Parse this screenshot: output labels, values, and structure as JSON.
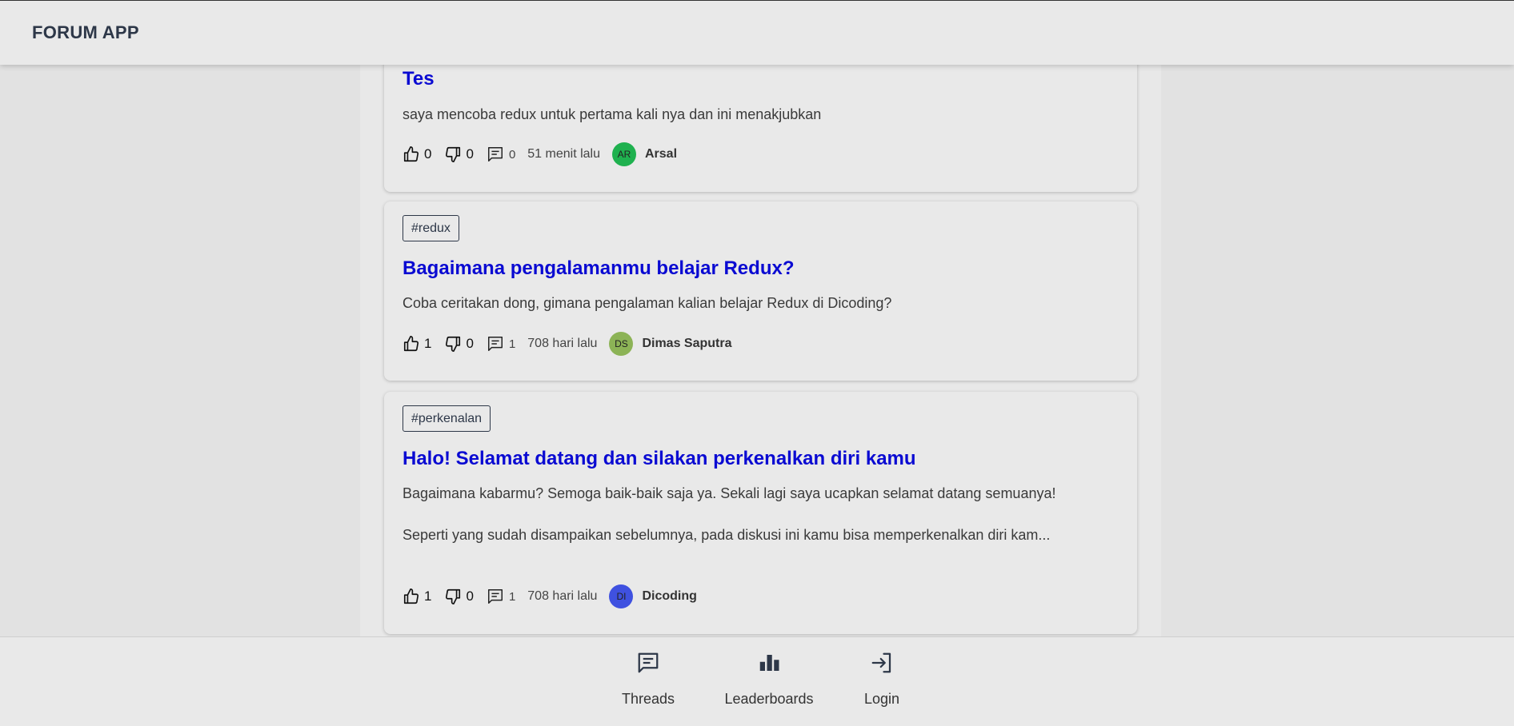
{
  "header": {
    "brand": "FORUM APP"
  },
  "threads": [
    {
      "title": "Tes",
      "body": [
        "saya mencoba redux untuk pertama kali nya dan ini menakjubkan"
      ],
      "upvotes": "0",
      "downvotes": "0",
      "comments": "0",
      "time": "51 menit lalu",
      "author": {
        "initials": "AR",
        "name": "Arsal",
        "color": "#1fb14f"
      }
    },
    {
      "tag": "#redux",
      "title": "Bagaimana pengalamanmu belajar Redux?",
      "body": [
        "Coba ceritakan dong, gimana pengalaman kalian belajar Redux di Dicoding?"
      ],
      "upvotes": "1",
      "downvotes": "0",
      "comments": "1",
      "time": "708 hari lalu",
      "author": {
        "initials": "DS",
        "name": "Dimas Saputra",
        "color": "#8cb356"
      }
    },
    {
      "tag": "#perkenalan",
      "title": "Halo! Selamat datang dan silakan perkenalkan diri kamu",
      "body": [
        "Bagaimana kabarmu? Semoga baik-baik saja ya. Sekali lagi saya ucapkan selamat datang semuanya!",
        "Seperti yang sudah disampaikan sebelumnya, pada diskusi ini kamu bisa memperkenalkan diri kam..."
      ],
      "upvotes": "1",
      "downvotes": "0",
      "comments": "1",
      "time": "708 hari lalu",
      "author": {
        "initials": "DI",
        "name": "Dicoding",
        "color": "#3f51e0"
      }
    }
  ],
  "nav": [
    {
      "label": "Threads",
      "icon": "chat-icon"
    },
    {
      "label": "Leaderboards",
      "icon": "bar-chart-icon"
    },
    {
      "label": "Login",
      "icon": "login-icon"
    }
  ]
}
